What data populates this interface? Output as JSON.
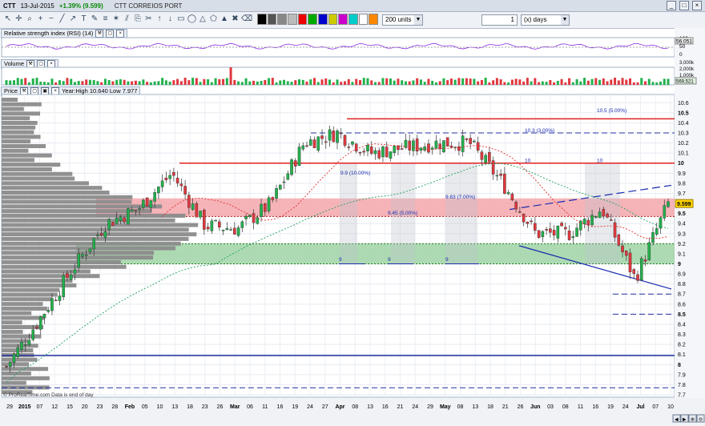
{
  "title_bar": {
    "symbol": "CTT",
    "date": "13-Jul-2015",
    "change": "+1.39% (9.599)",
    "name": "CTT CORREIOS PORT"
  },
  "toolbar": {
    "icons": [
      "pointer-icon",
      "crosshair-icon",
      "magnify-icon",
      "zoom-in-icon",
      "zoom-out-icon",
      "line-icon",
      "arrow-icon",
      "text-icon",
      "pencil-icon",
      "fib-icon",
      "gann-icon",
      "channel-icon",
      "copy-icon",
      "scissors-icon",
      "up-arrow-icon",
      "down-arrow-icon",
      "rectangle-icon",
      "ellipse-icon",
      "triangle-icon",
      "polygon-icon",
      "marker-icon",
      "delete-icon",
      "eraser-icon"
    ],
    "units_value": "200 units",
    "period_value": "1",
    "period_unit": "(x) days"
  },
  "rsi_panel": {
    "label": "Relative strength index (RSI) (14)",
    "current": "56.051",
    "axis": [
      "100",
      "50",
      "0"
    ]
  },
  "volume_panel": {
    "label": "Volume",
    "current": "569,521",
    "axis": [
      "3,000k",
      "2,000k",
      "1,000k",
      "0k"
    ]
  },
  "price_panel": {
    "label": "Price",
    "year_range": "Year:High 10.640 Low 7.977",
    "current_price": "9.599",
    "y_ticks": [
      "10.6",
      "10.5",
      "10.4",
      "10.3",
      "10.2",
      "10.1",
      "10",
      "9.9",
      "9.8",
      "9.7",
      "9.6",
      "9.5",
      "9.4",
      "9.3",
      "9.2",
      "9.1",
      "9",
      "8.9",
      "8.8",
      "8.7",
      "8.6",
      "8.5",
      "8.4",
      "8.3",
      "8.2",
      "8.1",
      "8",
      "7.9",
      "7.8",
      "7.7"
    ],
    "annotations": [
      "10.5 (5.00%)",
      "10.3 (3.00%)",
      "10",
      "10",
      "9.9 (10.00%)",
      "9.83 (7.00%)",
      "9.45 (5.00%)",
      "9",
      "9",
      "9"
    ],
    "footer_note": "© ProRealTime.com  Data is end of day"
  },
  "x_axis": [
    "29",
    "2015",
    "07",
    "12",
    "15",
    "20",
    "23",
    "28",
    "Feb",
    "05",
    "10",
    "13",
    "18",
    "23",
    "26",
    "Mar",
    "06",
    "11",
    "16",
    "19",
    "24",
    "27",
    "Apr",
    "08",
    "13",
    "16",
    "21",
    "24",
    "29",
    "May",
    "08",
    "13",
    "18",
    "21",
    "26",
    "Jun",
    "03",
    "08",
    "11",
    "16",
    "19",
    "24",
    "Jul",
    "07",
    "10"
  ],
  "colors": {
    "up": "#22b14c",
    "down": "#e0383e",
    "support_zone": "#9fd3a4",
    "resist_zone": "#f4a7ab",
    "hline_red": "#e02020",
    "hline_blue": "#2230a0",
    "trend": "#1a2ab0"
  },
  "chart_data": {
    "type": "candlestick",
    "title": "CTT CORREIOS PORT",
    "xlabel": "",
    "ylabel": "",
    "ylim": [
      7.7,
      10.65
    ],
    "dates": [
      "2015-01-05",
      "2015-01-15",
      "2015-01-26",
      "2015-02-05",
      "2015-02-16",
      "2015-02-26",
      "2015-03-06",
      "2015-03-16",
      "2015-03-26",
      "2015-04-07",
      "2015-04-14",
      "2015-04-22",
      "2015-04-30",
      "2015-05-11",
      "2015-05-20",
      "2015-05-29",
      "2015-06-08",
      "2015-06-17",
      "2015-06-26",
      "2015-07-06",
      "2015-07-13"
    ],
    "close": [
      7.98,
      8.45,
      8.95,
      9.4,
      9.55,
      9.9,
      9.38,
      9.35,
      9.6,
      10.2,
      10.3,
      10.1,
      10.15,
      10.2,
      10.2,
      9.8,
      9.3,
      9.3,
      9.55,
      8.85,
      9.599
    ],
    "horizontal_levels": [
      10.44,
      10.0,
      8.09
    ],
    "support_zone": [
      9.0,
      9.2
    ],
    "resistance_zone": [
      9.47,
      9.65
    ]
  }
}
